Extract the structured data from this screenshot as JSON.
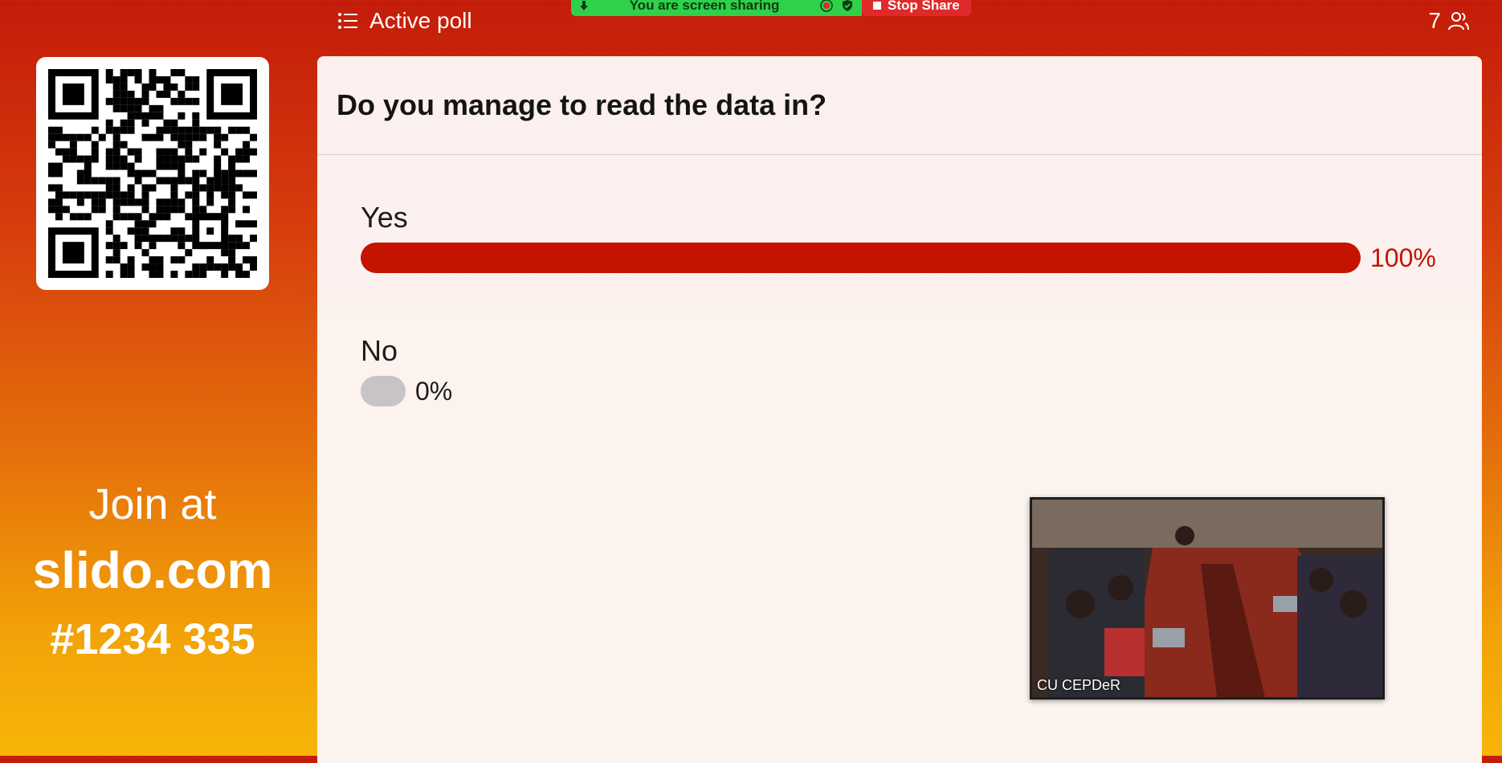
{
  "topbar": {
    "menu_icon": "list-icon",
    "title": "Active poll",
    "participant_count": "7",
    "participant_icon": "users-icon"
  },
  "screen_share": {
    "status_text": "You are screen sharing",
    "stop_label": "Stop Share",
    "color_status": "#2fd14a",
    "color_stop": "#e02a2a"
  },
  "sidebar": {
    "qr_icon": "qr-code-icon",
    "join_line1": "Join at",
    "join_line2": "slido.com",
    "join_line3": "#1234 335"
  },
  "poll": {
    "question": "Do you manage to read the data in?",
    "options": [
      {
        "label": "Yes",
        "percent_text": "100%",
        "fraction": 1.0
      },
      {
        "label": "No",
        "percent_text": "0%",
        "fraction": 0.0
      }
    ],
    "colors": {
      "bar": "#c41400",
      "bar_empty": "#c8c4c3",
      "pct_yes": "#c41400",
      "pct_no": "#1c1c1c"
    }
  },
  "video": {
    "participant_name": "CU CEPDeR"
  }
}
